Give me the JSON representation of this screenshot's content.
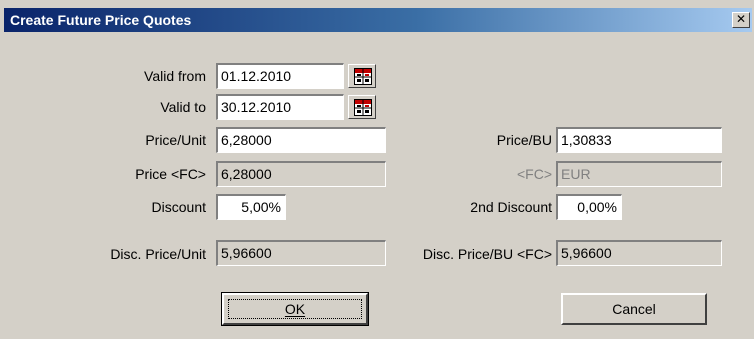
{
  "window": {
    "title": "Create Future Price Quotes",
    "close_glyph": "✕"
  },
  "form": {
    "valid_from": {
      "label": "Valid from",
      "value": "01.12.2010"
    },
    "valid_to": {
      "label": "Valid to",
      "value": "30.12.2010"
    },
    "price_unit": {
      "label": "Price/Unit",
      "value": "6,28000"
    },
    "price_fc": {
      "label": "Price <FC>",
      "value": "6,28000"
    },
    "discount": {
      "label": "Discount",
      "value": "5,00%"
    },
    "disc_price_unit": {
      "label": "Disc. Price/Unit",
      "value": "5,96600"
    },
    "price_bu": {
      "label": "Price/BU",
      "value": "1,30833"
    },
    "fc": {
      "label": "<FC>",
      "value": "EUR"
    },
    "second_discount": {
      "label": "2nd Discount",
      "value": "0,00%"
    },
    "disc_price_bu_fc": {
      "label": "Disc. Price/BU <FC>",
      "value": "5,96600"
    }
  },
  "buttons": {
    "ok": "OK",
    "cancel": "Cancel"
  },
  "icons": {
    "calendar": "calendar-icon",
    "close": "close-icon"
  },
  "colors": {
    "dialog_bg": "#d4d0c8",
    "titlebar_start": "#0a246a",
    "titlebar_end": "#a6caf0"
  }
}
